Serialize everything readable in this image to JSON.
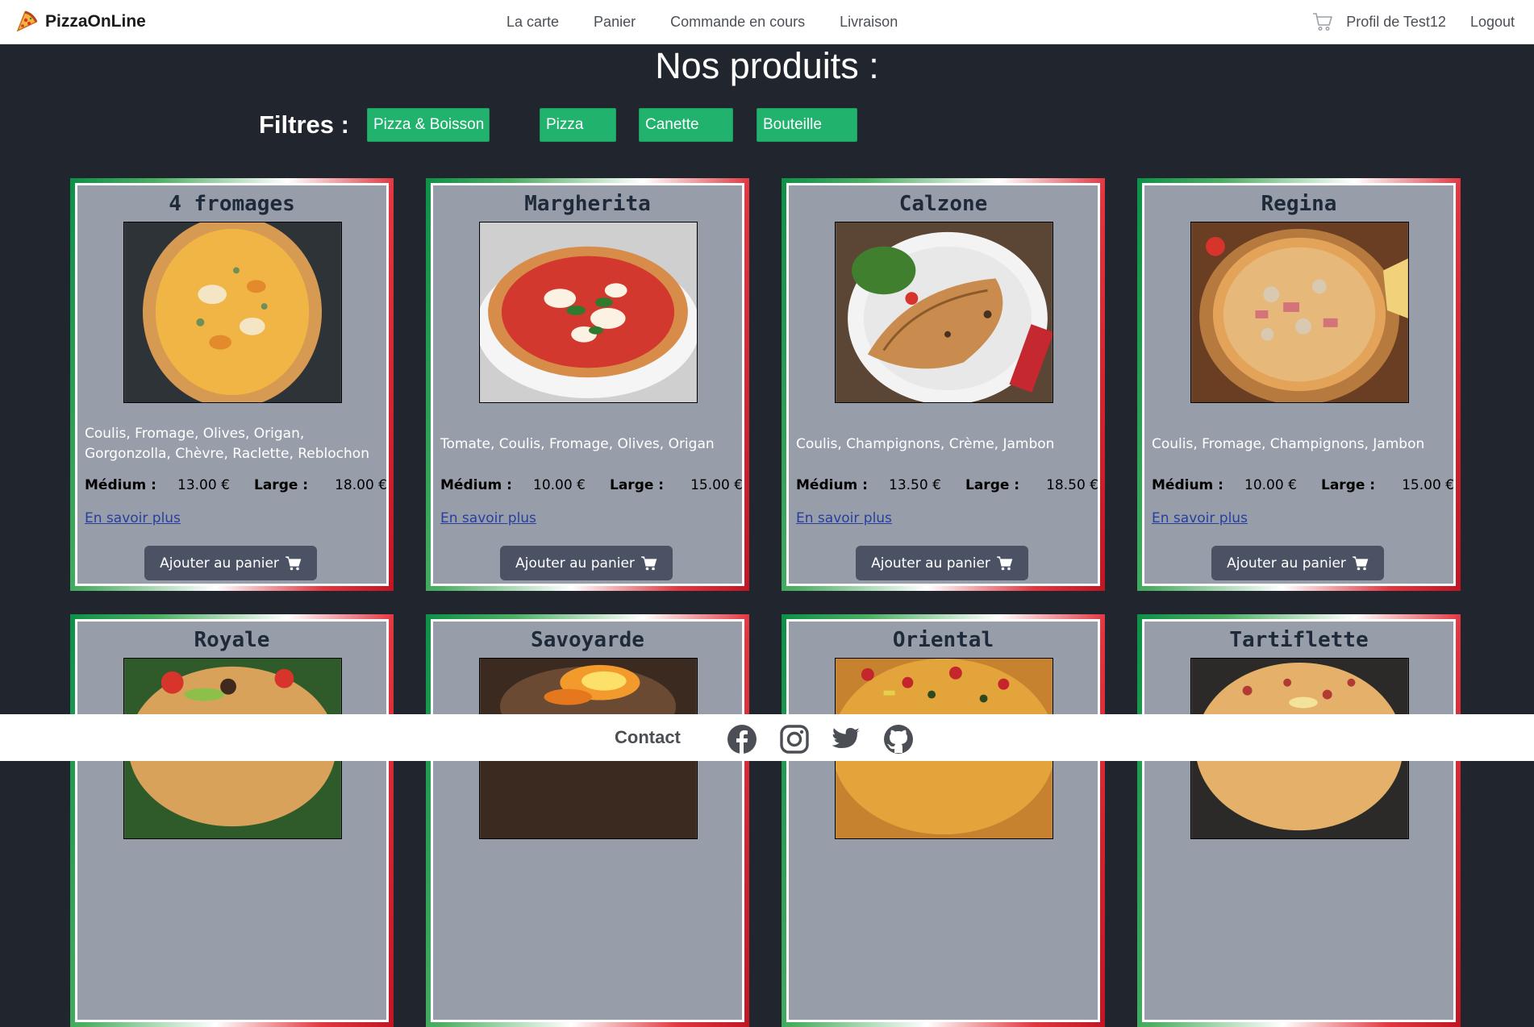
{
  "nav": {
    "brand": "PizzaOnLine",
    "links": [
      "La carte",
      "Panier",
      "Commande en cours",
      "Livraison"
    ],
    "profile": "Profil de Test12",
    "logout": "Logout"
  },
  "page_title": "Nos produits :",
  "filters": {
    "label": "Filtres :",
    "buttons": [
      "Pizza & Boisson",
      "Pizza",
      "Canette",
      "Bouteille"
    ]
  },
  "labels": {
    "medium": "Médium :",
    "large": "Large :",
    "more": "En savoir plus",
    "add_to_cart": "Ajouter au panier"
  },
  "products": [
    {
      "name": "4 fromages",
      "desc": "Coulis, Fromage, Olives, Origan, Gorgonzolla, Chèvre, Raclette, Reblochon",
      "medium": "13.00 €",
      "large": "18.00 €"
    },
    {
      "name": "Margherita",
      "desc": "Tomate, Coulis, Fromage, Olives, Origan",
      "medium": "10.00 €",
      "large": "15.00 €"
    },
    {
      "name": "Calzone",
      "desc": "Coulis, Champignons, Crème, Jambon",
      "medium": "13.50 €",
      "large": "18.50 €"
    },
    {
      "name": "Regina",
      "desc": "Coulis, Fromage, Champignons, Jambon",
      "medium": "10.00 €",
      "large": "15.00 €"
    },
    {
      "name": "Royale"
    },
    {
      "name": "Savoyarde"
    },
    {
      "name": "Oriental"
    },
    {
      "name": "Tartiflette"
    }
  ],
  "footer": {
    "contact": "Contact",
    "social_icons": [
      "facebook-icon",
      "instagram-icon",
      "twitter-icon",
      "github-icon"
    ]
  },
  "colors": {
    "background": "#20252e",
    "filter_green": "#21b26d",
    "card_bg": "#989ea9",
    "button_dark": "#4a5263",
    "link_blue": "#283e9e"
  }
}
